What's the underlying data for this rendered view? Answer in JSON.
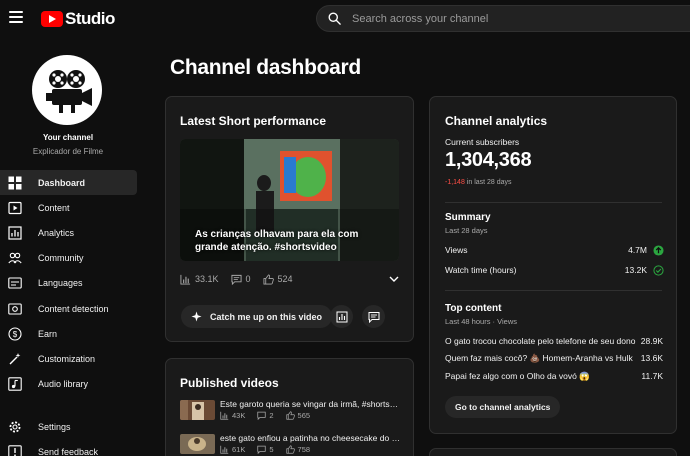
{
  "header": {
    "logo_text": "Studio",
    "search_placeholder": "Search across your channel"
  },
  "sidebar": {
    "your_channel_label": "Your channel",
    "channel_name": "Explicador de Filme",
    "items": [
      {
        "label": "Dashboard",
        "icon": "dashboard-icon",
        "active": true
      },
      {
        "label": "Content",
        "icon": "content-icon"
      },
      {
        "label": "Analytics",
        "icon": "analytics-icon"
      },
      {
        "label": "Community",
        "icon": "community-icon"
      },
      {
        "label": "Languages",
        "icon": "languages-icon"
      },
      {
        "label": "Content detection",
        "icon": "content-detection-icon"
      },
      {
        "label": "Earn",
        "icon": "earn-icon"
      },
      {
        "label": "Customization",
        "icon": "customization-icon"
      },
      {
        "label": "Audio library",
        "icon": "audio-library-icon"
      }
    ],
    "bottom_items": [
      {
        "label": "Settings",
        "icon": "settings-icon"
      },
      {
        "label": "Send feedback",
        "icon": "feedback-icon"
      }
    ]
  },
  "main": {
    "page_title": "Channel dashboard"
  },
  "latest_short": {
    "title": "Latest Short performance",
    "caption": "As crianças olhavam para ela com grande atenção. #shortsvideo",
    "views": "33.1K",
    "comments": "0",
    "likes": "524",
    "catch_up_label": "Catch me up on this video"
  },
  "published": {
    "title": "Published videos",
    "videos": [
      {
        "title": "Este garoto queria se vingar da irmã, #shortsvideo",
        "views": "43K",
        "comments": "2",
        "likes": "565"
      },
      {
        "title": "este gato enfiou a patinha no cheesecake do dono",
        "views": "61K",
        "comments": "5",
        "likes": "758"
      }
    ]
  },
  "analytics": {
    "title": "Channel analytics",
    "subs_label": "Current subscribers",
    "subs_count": "1,304,368",
    "subs_delta": "-1,148",
    "subs_delta_suffix": " in last 28 days",
    "summary_title": "Summary",
    "summary_sub": "Last 28 days",
    "metrics": [
      {
        "label": "Views",
        "value": "4.7M",
        "status": "up"
      },
      {
        "label": "Watch time (hours)",
        "value": "13.2K",
        "status": "ok"
      }
    ],
    "top_title": "Top content",
    "top_sub": "Last 48 hours · Views",
    "top_items": [
      {
        "title": "O gato trocou chocolate pelo telefone de seu dono",
        "views": "28.9K"
      },
      {
        "title": "Quem faz mais cocô? 💩 Homem-Aranha vs Hulk",
        "views": "13.6K"
      },
      {
        "title": "Papai fez algo com o Olho da vovó 😱",
        "views": "11.7K"
      }
    ],
    "goto_label": "Go to channel analytics",
    "colors": {
      "accent_green": "#2ba640",
      "negative_red": "#ff4e45",
      "brand_red": "#ff0000"
    }
  }
}
